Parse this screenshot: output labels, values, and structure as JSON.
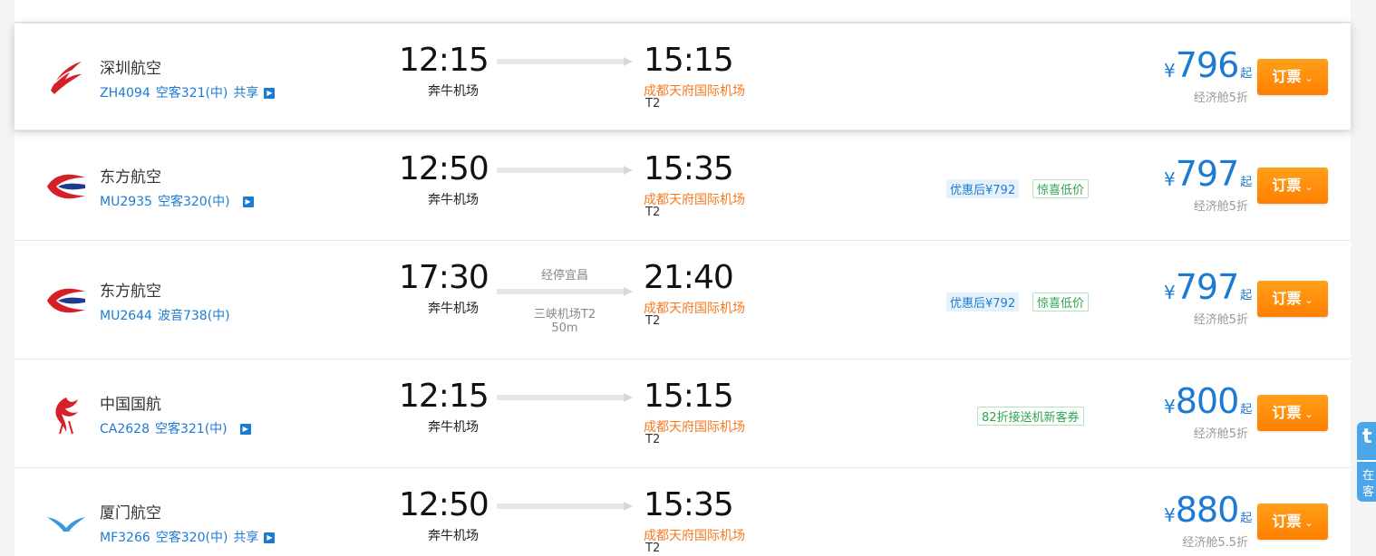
{
  "flights": [
    {
      "airline": "深圳航空",
      "flight_no": "ZH4094",
      "aircraft": "空客321(中)",
      "share": "共享",
      "dep_time": "12:15",
      "dep_airport": "奔牛机场",
      "arr_time": "15:15",
      "arr_airport": "成都天府国际机场",
      "arr_terminal": "T2",
      "currency": "¥",
      "price": "796",
      "price_suffix": "起",
      "cabin": "经济舱5折",
      "book_label": "订票"
    },
    {
      "airline": "东方航空",
      "flight_no": "MU2935",
      "aircraft": "空客320(中)",
      "dep_time": "12:50",
      "dep_airport": "奔牛机场",
      "arr_time": "15:35",
      "arr_airport": "成都天府国际机场",
      "arr_terminal": "T2",
      "discount_tag": "优惠后¥792",
      "promo_tag": "惊喜低价",
      "currency": "¥",
      "price": "797",
      "price_suffix": "起",
      "cabin": "经济舱5折",
      "book_label": "订票"
    },
    {
      "airline": "东方航空",
      "flight_no": "MU2644",
      "aircraft": "波音738(中)",
      "dep_time": "17:30",
      "dep_airport": "奔牛机场",
      "stopover": "经停宜昌",
      "stop_airport": "三峡机场T2",
      "stop_duration": "50m",
      "arr_time": "21:40",
      "arr_airport": "成都天府国际机场",
      "arr_terminal": "T2",
      "discount_tag": "优惠后¥792",
      "promo_tag": "惊喜低价",
      "currency": "¥",
      "price": "797",
      "price_suffix": "起",
      "cabin": "经济舱5折",
      "book_label": "订票"
    },
    {
      "airline": "中国国航",
      "flight_no": "CA2628",
      "aircraft": "空客321(中)",
      "dep_time": "12:15",
      "dep_airport": "奔牛机场",
      "arr_time": "15:15",
      "arr_airport": "成都天府国际机场",
      "arr_terminal": "T2",
      "promo_tag": "82折接送机新客券",
      "currency": "¥",
      "price": "800",
      "price_suffix": "起",
      "cabin": "经济舱5折",
      "book_label": "订票"
    },
    {
      "airline": "厦门航空",
      "flight_no": "MF3266",
      "aircraft": "空客320(中)",
      "share": "共享",
      "dep_time": "12:50",
      "dep_airport": "奔牛机场",
      "arr_time": "15:35",
      "arr_airport": "成都天府国际机场",
      "arr_terminal": "T2",
      "currency": "¥",
      "price": "880",
      "price_suffix": "起",
      "cabin": "经济舱5.5折",
      "book_label": "订票"
    }
  ],
  "side_widget": {
    "top": "在",
    "bottom": "客"
  },
  "colors": {
    "accent_blue": "#1b7bd4",
    "book_orange": "#ff8c00",
    "arrival_orange": "#f47920",
    "promo_green": "#2da44e"
  }
}
